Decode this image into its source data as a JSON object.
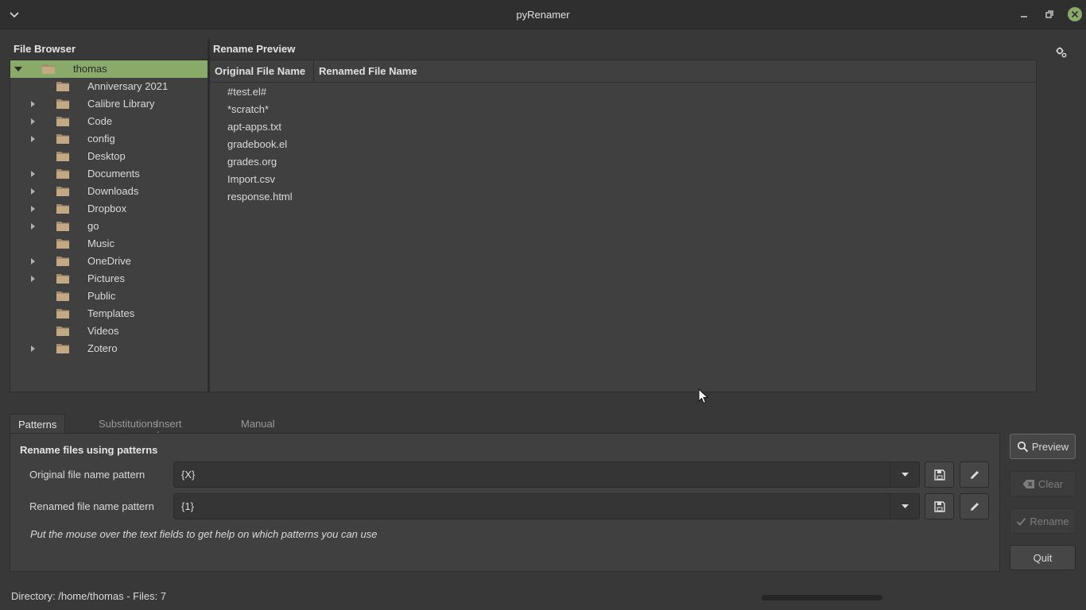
{
  "window": {
    "title": "pyRenamer"
  },
  "file_browser": {
    "heading": "File Browser",
    "items": [
      {
        "label": "thomas",
        "expandable": true,
        "expanded": true,
        "selected": true,
        "depth": 0
      },
      {
        "label": "Anniversary 2021",
        "expandable": false,
        "depth": 1
      },
      {
        "label": "Calibre Library",
        "expandable": true,
        "depth": 1
      },
      {
        "label": "Code",
        "expandable": true,
        "depth": 1
      },
      {
        "label": "config",
        "expandable": true,
        "depth": 1
      },
      {
        "label": "Desktop",
        "expandable": false,
        "depth": 1
      },
      {
        "label": "Documents",
        "expandable": true,
        "depth": 1
      },
      {
        "label": "Downloads",
        "expandable": true,
        "depth": 1
      },
      {
        "label": "Dropbox",
        "expandable": true,
        "depth": 1
      },
      {
        "label": "go",
        "expandable": true,
        "depth": 1
      },
      {
        "label": "Music",
        "expandable": false,
        "depth": 1
      },
      {
        "label": "OneDrive",
        "expandable": true,
        "depth": 1
      },
      {
        "label": "Pictures",
        "expandable": true,
        "depth": 1
      },
      {
        "label": "Public",
        "expandable": false,
        "depth": 1
      },
      {
        "label": "Templates",
        "expandable": false,
        "depth": 1
      },
      {
        "label": "Videos",
        "expandable": false,
        "depth": 1
      },
      {
        "label": "Zotero",
        "expandable": true,
        "depth": 1
      }
    ]
  },
  "rename_preview": {
    "heading": "Rename Preview",
    "columns": [
      "Original File Name",
      "Renamed File Name"
    ],
    "files": [
      "#test.el#",
      "*scratch*",
      "apt-apps.txt",
      "gradebook.el",
      "grades.org",
      "Import.csv",
      "response.html"
    ]
  },
  "tabs": [
    "Patterns",
    "Substitutions",
    "Insert / Delete",
    "Manual rename"
  ],
  "active_tab": "Patterns",
  "patterns": {
    "heading": "Rename files using patterns",
    "original_label": "Original file name pattern",
    "original_value": "{X}",
    "renamed_label": "Renamed file name pattern",
    "renamed_value": "{1}",
    "hint": "Put the mouse over the text fields to get help on which patterns you can use"
  },
  "buttons": {
    "preview": "Preview",
    "clear": "Clear",
    "rename": "Rename",
    "quit": "Quit"
  },
  "status": "Directory: /home/thomas - Files: 7",
  "colors": {
    "accent": "#8aaa6a",
    "background": "#383838",
    "panel": "#404040"
  }
}
